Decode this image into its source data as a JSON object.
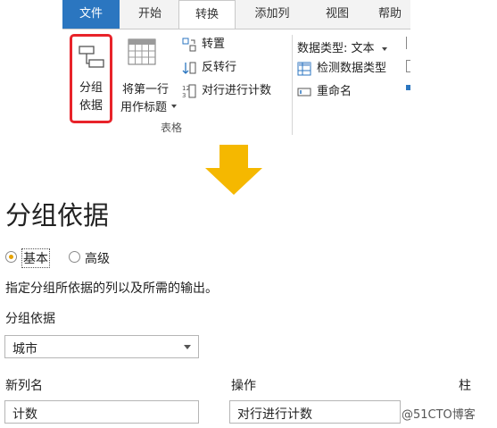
{
  "ribbon": {
    "tabs": [
      "文件",
      "开始",
      "转换",
      "添加列",
      "视图",
      "帮助"
    ],
    "group_by": {
      "line1": "分组",
      "line2": "依据"
    },
    "use_header": {
      "line1": "将第一行",
      "line2": "用作标题"
    },
    "transpose": "转置",
    "reverse_rows": "反转行",
    "count_rows": "对行进行计数",
    "group_label": "表格",
    "data_type": "数据类型: 文本",
    "detect_type": "检测数据类型",
    "rename": "重命名"
  },
  "dialog": {
    "title": "分组依据",
    "radio_basic": "基本",
    "radio_advanced": "高级",
    "description": "指定分组所依据的列以及所需的输出。",
    "group_by_label": "分组依据",
    "group_by_value": "城市",
    "new_col_label": "新列名",
    "operation_label": "操作",
    "column_label": "柱",
    "new_col_value": "计数",
    "operation_value": "对行进行计数"
  },
  "watermark": "@51CTO博客",
  "colors": {
    "file_tab": "#2b76c0",
    "highlight": "#e8232a",
    "arrow": "#f5b800",
    "radio_dot": "#e6a200"
  }
}
